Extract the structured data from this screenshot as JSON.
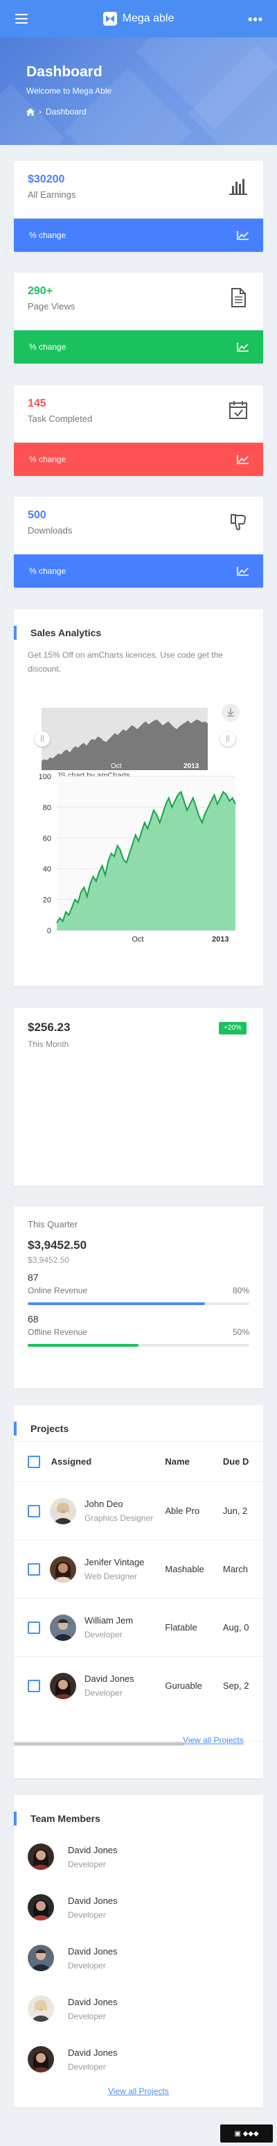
{
  "app": {
    "brand": "Mega able"
  },
  "banner": {
    "title": "Dashboard",
    "welcome": "Welcome to Mega Able",
    "crumb": "Dashboard"
  },
  "stats": [
    {
      "value": "$30200",
      "label": "All Earnings",
      "change": "% change",
      "color": "#4680ff",
      "bar_color": "#4680ff",
      "icon": "bar-chart-icon"
    },
    {
      "value": "290+",
      "label": "Page Views",
      "change": "% change",
      "color": "#1bc15c",
      "bar_color": "#1bc15c",
      "icon": "file-icon"
    },
    {
      "value": "145",
      "label": "Task Completed",
      "change": "% change",
      "color": "#ff5252",
      "bar_color": "#ff5252",
      "icon": "calendar-check-icon"
    },
    {
      "value": "500",
      "label": "Downloads",
      "change": "% change",
      "color": "#4680ff",
      "bar_color": "#4680ff",
      "icon": "thumbs-down-icon"
    }
  ],
  "sales": {
    "title": "Sales Analytics",
    "subtitle": "Get 15% Off on amCharts licences. Use code get the discount.",
    "credit": "JS chart by amCharts"
  },
  "chart_data": {
    "type": "area",
    "title": "",
    "xlabel": "",
    "ylabel": "",
    "ylim": [
      0,
      100
    ],
    "yticks": [
      "100",
      "80",
      "60",
      "40",
      "20",
      "0"
    ],
    "xticks": [
      "Oct",
      "2013"
    ],
    "x": [
      0,
      1,
      2,
      3,
      4,
      5,
      6,
      7,
      8,
      9,
      10,
      11,
      12,
      13,
      14,
      15,
      16,
      17,
      18,
      19,
      20,
      21,
      22,
      23,
      24,
      25,
      26,
      27,
      28,
      29,
      30,
      31,
      32,
      33,
      34,
      35,
      36,
      37,
      38,
      39,
      40,
      41,
      42,
      43,
      44,
      45,
      46,
      47,
      48,
      49,
      50,
      51,
      52,
      53,
      54,
      55,
      56,
      57,
      58,
      59
    ],
    "series": [
      {
        "values": [
          5,
          8,
          6,
          12,
          10,
          15,
          20,
          18,
          25,
          28,
          22,
          30,
          35,
          32,
          38,
          42,
          36,
          45,
          50,
          48,
          55,
          52,
          46,
          44,
          50,
          56,
          62,
          58,
          64,
          70,
          66,
          72,
          78,
          75,
          70,
          76,
          82,
          86,
          80,
          84,
          88,
          90,
          84,
          78,
          82,
          86,
          80,
          74,
          70,
          76,
          80,
          84,
          88,
          82,
          86,
          90,
          88,
          84,
          86,
          82
        ]
      }
    ],
    "navigator": {
      "xticks": [
        "Oct",
        "2013"
      ]
    }
  },
  "earning": {
    "value": "$256.23",
    "label": "This Month",
    "badge": "+20%"
  },
  "quarter": {
    "title": "This Quarter",
    "value": "$3,9452.50",
    "sub": "$3,9452.50",
    "items": [
      {
        "num": "87",
        "label": "Online Revenue",
        "pct": "80%",
        "fill": 0.8,
        "color": "#4a8ef3"
      },
      {
        "num": "68",
        "label": "Offline Revenue",
        "pct": "50%",
        "fill": 0.5,
        "color": "#1bc15c"
      }
    ]
  },
  "projects": {
    "title": "Projects",
    "headers": {
      "assigned": "Assigned",
      "name": "Name",
      "due": "Due D"
    },
    "rows": [
      {
        "name": "John Deo",
        "role": "Graphics Designer",
        "project": "Able Pro",
        "due": "Jun, 2"
      },
      {
        "name": "Jenifer Vintage",
        "role": "Web Designer",
        "project": "Mashable",
        "due": "March"
      },
      {
        "name": "William Jem",
        "role": "Developer",
        "project": "Flatable",
        "due": "Aug, 0"
      },
      {
        "name": "David Jones",
        "role": "Developer",
        "project": "Guruable",
        "due": "Sep, 2"
      }
    ],
    "link": "View all Projects"
  },
  "team": {
    "title": "Team Members",
    "members": [
      {
        "name": "David Jones",
        "role": "Developer"
      },
      {
        "name": "David Jones",
        "role": "Developer"
      },
      {
        "name": "David Jones",
        "role": "Developer"
      },
      {
        "name": "David Jones",
        "role": "Developer"
      },
      {
        "name": "David Jones",
        "role": "Developer"
      }
    ],
    "link": "View all Projects"
  }
}
